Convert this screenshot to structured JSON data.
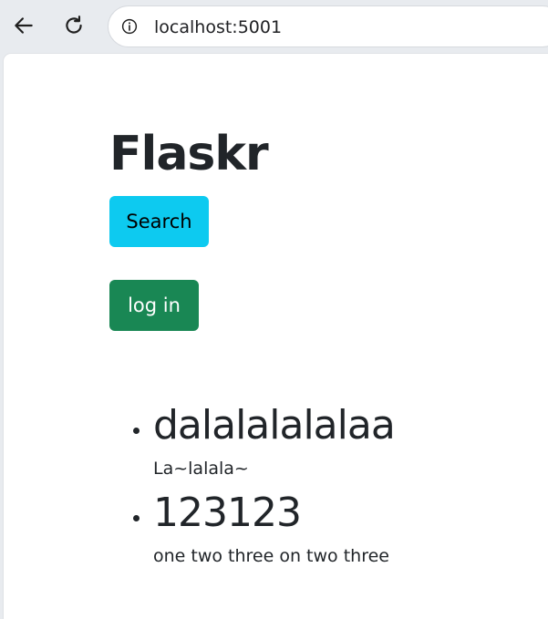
{
  "browser": {
    "url": "localhost:5001",
    "back_icon": "back-arrow-icon",
    "reload_icon": "reload-icon",
    "site_info_icon": "info-icon"
  },
  "page": {
    "title": "Flaskr",
    "search_button": "Search",
    "login_button": "log in",
    "search_button_color": "#0dcaf0",
    "login_button_color": "#198754"
  },
  "posts": [
    {
      "title": "dalalalalalaa",
      "body": "La~lalala~"
    },
    {
      "title": "123123",
      "body": "one two three on two three"
    }
  ]
}
